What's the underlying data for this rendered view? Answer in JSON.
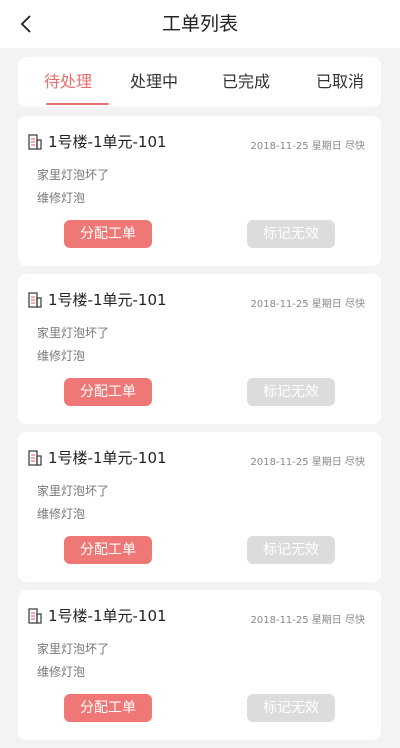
{
  "header": {
    "title": "工单列表"
  },
  "tabs": [
    {
      "label": "待处理",
      "active": true
    },
    {
      "label": "处理中",
      "active": false
    },
    {
      "label": "已完成",
      "active": false
    },
    {
      "label": "已取消",
      "active": false
    }
  ],
  "orders": [
    {
      "address": "1号楼-1单元-101",
      "date": "2018-11-25 星期日 尽快",
      "description": "家里灯泡坏了",
      "note": "维修灯泡",
      "assign_label": "分配工单",
      "invalid_label": "标记无效"
    },
    {
      "address": "1号楼-1单元-101",
      "date": "2018-11-25 星期日 尽快",
      "description": "家里灯泡坏了",
      "note": "维修灯泡",
      "assign_label": "分配工单",
      "invalid_label": "标记无效"
    },
    {
      "address": "1号楼-1单元-101",
      "date": "2018-11-25 星期日 尽快",
      "description": "家里灯泡坏了",
      "note": "维修灯泡",
      "assign_label": "分配工单",
      "invalid_label": "标记无效"
    },
    {
      "address": "1号楼-1单元-101",
      "date": "2018-11-25 星期日 尽快",
      "description": "家里灯泡坏了",
      "note": "维修灯泡",
      "assign_label": "分配工单",
      "invalid_label": "标记无效"
    }
  ],
  "colors": {
    "accent": "#e86f6d",
    "assign_button": "#ef7776",
    "disabled_button": "#dcdcdc",
    "background": "#f4f2f3"
  },
  "icons": {
    "back": "chevron-left-icon",
    "address": "building-icon"
  }
}
